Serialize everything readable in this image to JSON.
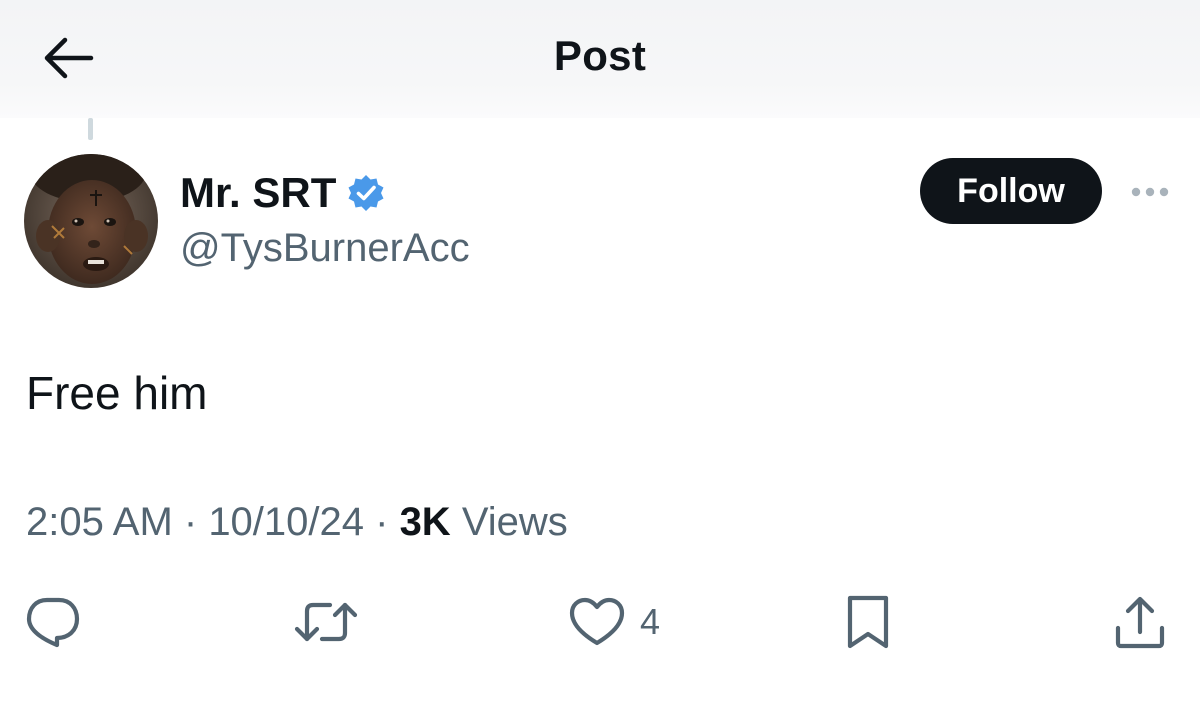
{
  "header": {
    "title": "Post",
    "back_icon": "arrow-left-icon"
  },
  "author": {
    "display_name": "Mr. SRT",
    "handle": "@TysBurnerAcc",
    "verified": true,
    "verified_color": "#4a99e9",
    "avatar_icon": "avatar-photo"
  },
  "follow_label": "Follow",
  "more_icon": "more-dots-icon",
  "post": {
    "text": "Free him"
  },
  "meta": {
    "time": "2:05 AM",
    "separator": " · ",
    "date": "10/10/24",
    "views_count": "3K",
    "views_label": "Views"
  },
  "actions": {
    "reply_icon": "reply-icon",
    "repost_icon": "repost-icon",
    "like_icon": "heart-icon",
    "like_count": "4",
    "bookmark_icon": "bookmark-icon",
    "share_icon": "share-icon"
  },
  "colors": {
    "text_primary": "#0f1419",
    "text_secondary": "#536471",
    "follow_bg": "#0f1419",
    "follow_text": "#ffffff"
  }
}
